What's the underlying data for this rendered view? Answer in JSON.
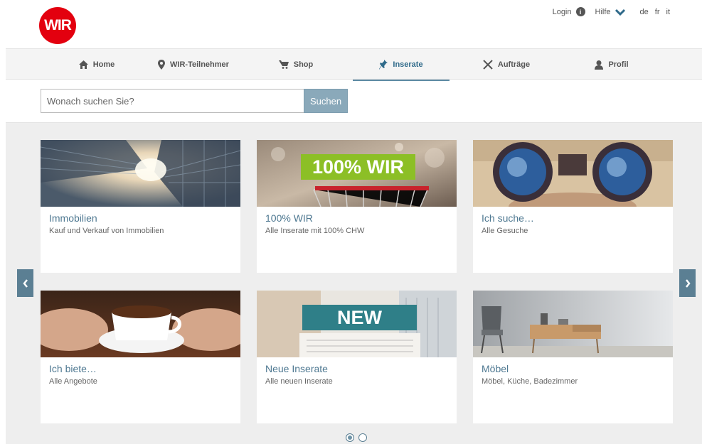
{
  "brand": {
    "logo_text": "WIR",
    "logo_color": "#e3000f"
  },
  "topbar": {
    "login": "Login",
    "help": "Hilfe",
    "languages": [
      "de",
      "fr",
      "it"
    ]
  },
  "nav": {
    "items": [
      {
        "label": "Home",
        "icon": "home-icon"
      },
      {
        "label": "WIR-Teilnehmer",
        "icon": "map-pin-icon"
      },
      {
        "label": "Shop",
        "icon": "cart-icon"
      },
      {
        "label": "Inserate",
        "icon": "pushpin-icon",
        "active": true
      },
      {
        "label": "Aufträge",
        "icon": "tools-icon"
      },
      {
        "label": "Profil",
        "icon": "user-icon"
      }
    ]
  },
  "search": {
    "placeholder": "Wonach suchen Sie?",
    "button": "Suchen"
  },
  "cards": [
    {
      "title": "Immobilien",
      "subtitle": "Kauf und Verkauf von Immobilien",
      "image": "skyscrapers-photo"
    },
    {
      "title": "100% WIR",
      "subtitle": "Alle Inserate mit 100% CHW",
      "image": "shopping-cart-photo",
      "overlay": "100% WIR"
    },
    {
      "title": "Ich suche…",
      "subtitle": "Alle Gesuche",
      "image": "binoculars-photo"
    },
    {
      "title": "Ich biete…",
      "subtitle": "Alle Angebote",
      "image": "coffee-cup-photo"
    },
    {
      "title": "Neue Inserate",
      "subtitle": "Alle neuen Inserate",
      "image": "newspaper-photo",
      "overlay": "NEW"
    },
    {
      "title": "Möbel",
      "subtitle": "Möbel, Küche, Badezimmer",
      "image": "furniture-photo"
    }
  ],
  "carousel": {
    "pages": 2,
    "current": 1
  },
  "colors": {
    "accent": "#5b7f93",
    "title": "#4e7891",
    "button": "#8aa9ba",
    "overlay_green": "#8cbf26",
    "overlay_teal": "#2f7f88"
  }
}
